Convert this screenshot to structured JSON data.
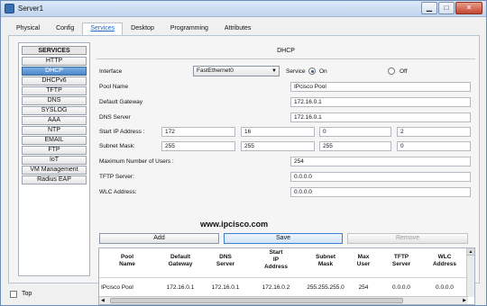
{
  "window": {
    "title": "Server1"
  },
  "tabs": [
    "Physical",
    "Config",
    "Services",
    "Desktop",
    "Programming",
    "Attributes"
  ],
  "services": {
    "header": "SERVICES",
    "items": [
      "HTTP",
      "DHCP",
      "DHCPv6",
      "TFTP",
      "DNS",
      "SYSLOG",
      "AAA",
      "NTP",
      "EMAIL",
      "FTP",
      "IoT",
      "VM Management",
      "Radius EAP"
    ]
  },
  "dhcp": {
    "title": "DHCP",
    "interface_label": "Interface",
    "interface_value": "FastEthernet0",
    "service_label": "Service",
    "on_label": "On",
    "off_label": "Off",
    "pool_name_label": "Pool Name",
    "pool_name_value": "IPcisco Pool",
    "gateway_label": "Default Gateway",
    "gateway_value": "172.16.0.1",
    "dns_label": "DNS Server",
    "dns_value": "172.16.0.1",
    "start_ip_label": "Start IP Address :",
    "start_ip": [
      "172",
      "16",
      "0",
      "2"
    ],
    "subnet_label": "Subnet Mask:",
    "subnet": [
      "255",
      "255",
      "255",
      "0"
    ],
    "max_users_label": "Maximum Number of Users :",
    "max_users_value": "254",
    "tftp_label": "TFTP Server:",
    "tftp_value": "0.0.0.0",
    "wlc_label": "WLC Address:",
    "wlc_value": "0.0.0.0",
    "add_label": "Add",
    "save_label": "Save",
    "remove_label": "Remove"
  },
  "watermark": "www.ipcisco.com",
  "table": {
    "headers": [
      "Pool\nName",
      "Default\nGateway",
      "DNS\nServer",
      "Start\nIP\nAddress",
      "Subnet\nMask",
      "Max\nUser",
      "TFTP\nServer",
      "WLC\nAddress"
    ],
    "row": [
      "IPcisco Pool",
      "172.16.0.1",
      "172.16.0.1",
      "172.16.0.2",
      "255.255.255.0",
      "254",
      "0.0.0.0",
      "0.0.0.0"
    ]
  },
  "bottom": {
    "top_label": "Top"
  }
}
